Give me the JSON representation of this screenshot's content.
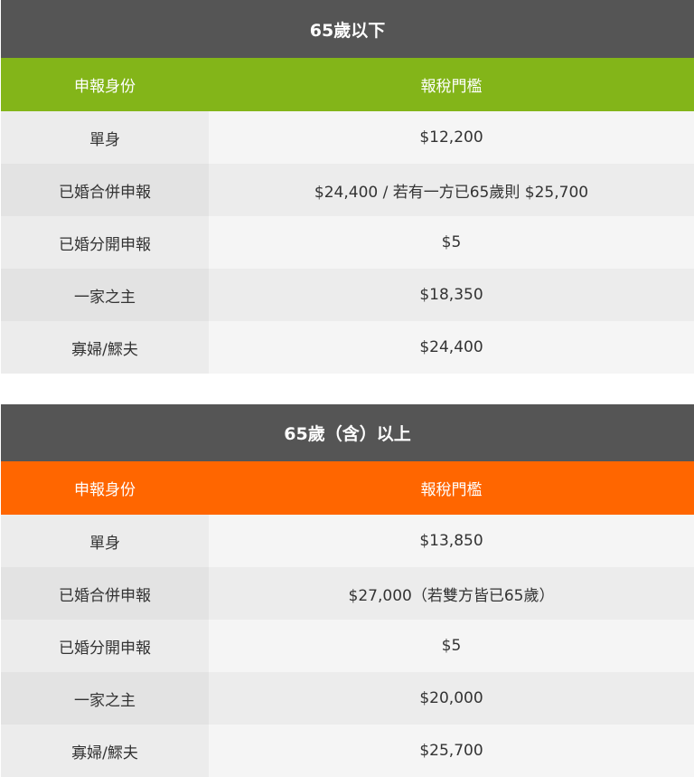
{
  "tables": [
    {
      "title": "65歲以下",
      "header": {
        "status": "申報身份",
        "threshold": "報稅門檻"
      },
      "header_color": "#83b519",
      "rows": [
        {
          "status": "單身",
          "threshold": "$12,200"
        },
        {
          "status": "已婚合併申報",
          "threshold": "$24,400 / 若有一方已65歲則 $25,700"
        },
        {
          "status": "已婚分開申報",
          "threshold": "$5"
        },
        {
          "status": "一家之主",
          "threshold": "$18,350"
        },
        {
          "status": "寡婦/鰥夫",
          "threshold": "$24,400"
        }
      ]
    },
    {
      "title": "65歲（含）以上",
      "header": {
        "status": "申報身份",
        "threshold": "報稅門檻"
      },
      "header_color": "#ff6600",
      "rows": [
        {
          "status": "單身",
          "threshold": "$13,850"
        },
        {
          "status": "已婚合併申報",
          "threshold": "$27,000（若雙方皆已65歲）"
        },
        {
          "status": "已婚分開申報",
          "threshold": "$5"
        },
        {
          "status": "一家之主",
          "threshold": "$20,000"
        },
        {
          "status": "寡婦/鰥夫",
          "threshold": "$25,700"
        }
      ]
    }
  ],
  "colors": {
    "title_bg": "#555555",
    "row_light": "#f5f5f5",
    "row_dark": "#ececec"
  }
}
